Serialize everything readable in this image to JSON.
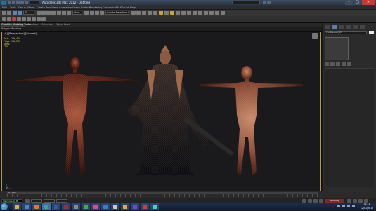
{
  "window": {
    "title": "Autodesk 3ds Max 2012 - Untitled",
    "controls": {
      "minimize": "–",
      "maximize": "□",
      "close": "✕"
    }
  },
  "menus": [
    "Edit",
    "Tools",
    "Group",
    "Views",
    "Create",
    "Modifiers",
    "Animation",
    "Graph Editors",
    "Rendering",
    "Customize",
    "MAXScript",
    "Help"
  ],
  "toolbar": {
    "selection_filter": "All",
    "ref_coord": "View",
    "selection_set": "Create Selection Se"
  },
  "ribbon": {
    "tabs": [
      "Graphite Modeling Tools",
      "Freeform",
      "Selection",
      "Object Paint"
    ],
    "active_tab": 0,
    "sub_label": "Polygon Modeling"
  },
  "viewport": {
    "label": "[+] [Perspective] [Shaded]",
    "stats": {
      "labels": [
        "Total",
        "Polys:",
        "Verts:"
      ],
      "values": [
        "",
        "296,400",
        "148,265"
      ],
      "fps_label": "FPS:"
    }
  },
  "command_panel": {
    "object_name": "Hellbound_01",
    "object_color": "#e8e8e8"
  },
  "timeline": {
    "frame": "0 / 100"
  },
  "statusbar": {
    "script": "Welcome to M",
    "autokey": "Auto Key"
  },
  "taskbar": {
    "time": "18:48",
    "date": "12/01/2012"
  },
  "colors": {
    "viewport_border": "#b59d2a",
    "close_button": "#c63a32"
  }
}
